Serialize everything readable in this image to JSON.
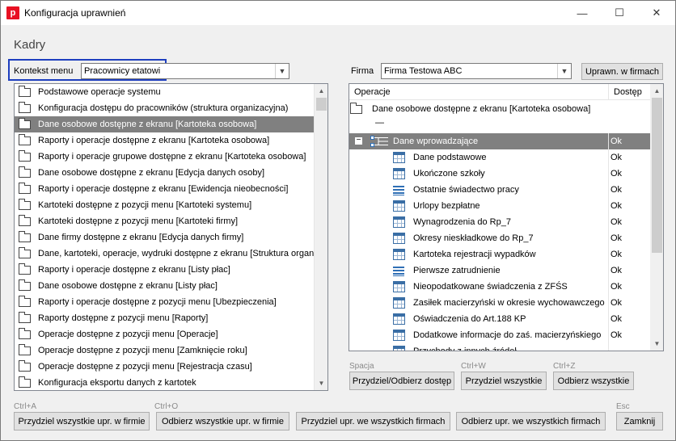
{
  "window": {
    "title": "Konfiguracja uprawnień",
    "app_icon_letter": "p"
  },
  "controls": {
    "minimize": "—",
    "maximize": "☐",
    "close": "✕"
  },
  "heading": "Kadry",
  "context": {
    "label": "Kontekst menu",
    "value": "Pracownicy etatowi"
  },
  "firma": {
    "label": "Firma",
    "value": "Firma Testowa ABC",
    "button": "Uprawn. w firmach"
  },
  "left_list": [
    "Podstawowe operacje systemu",
    "Konfiguracja dostępu do pracowników (struktura organizacyjna)",
    "Dane osobowe dostępne z ekranu [Kartoteka osobowa]",
    "Raporty i operacje dostępne z ekranu [Kartoteka osobowa]",
    "Raporty i operacje grupowe dostępne z ekranu [Kartoteka osobowa]",
    "Dane osobowe dostępne z ekranu [Edycja danych osoby]",
    "Raporty i operacje dostępne z ekranu [Ewidencja nieobecności]",
    "Kartoteki dostępne z pozycji menu [Kartoteki systemu]",
    "Kartoteki dostępne z pozycji menu [Kartoteki firmy]",
    "Dane firmy dostępne z ekranu [Edycja danych firmy]",
    "Dane, kartoteki, operacje, wydruki dostępne z ekranu [Struktura organiz",
    "Raporty i operacje dostępne z ekranu [Listy płac]",
    "Dane osobowe dostępne z ekranu [Listy płac]",
    "Raporty i operacje dostępne z pozycji menu [Ubezpieczenia]",
    "Raporty dostępne z pozycji menu [Raporty]",
    "Operacje dostępne z pozycji menu [Operacje]",
    "Operacje dostępne z pozycji menu [Zamknięcie roku]",
    "Operacje dostępne z pozycji menu [Rejestracja czasu]",
    "Konfiguracja eksportu danych z kartotek"
  ],
  "left_selected_index": 2,
  "tree": {
    "col_operacje": "Operacje",
    "col_dostep": "Dostęp",
    "root": "Dane osobowe dostępne z ekranu [Kartoteka osobowa]",
    "dash": "—",
    "group": {
      "name": "Dane wprowadzające",
      "access": "Ok"
    },
    "items": [
      {
        "name": "Dane podstawowe",
        "access": "Ok",
        "icon": "table-icon"
      },
      {
        "name": "Ukończone szkoły",
        "access": "Ok",
        "icon": "table-icon"
      },
      {
        "name": "Ostatnie świadectwo pracy",
        "access": "Ok",
        "icon": "stack-icon"
      },
      {
        "name": "Urlopy bezpłatne",
        "access": "Ok",
        "icon": "table-icon"
      },
      {
        "name": "Wynagrodzenia do Rp_7",
        "access": "Ok",
        "icon": "table-icon"
      },
      {
        "name": "Okresy nieskładkowe do Rp_7",
        "access": "Ok",
        "icon": "table-icon"
      },
      {
        "name": "Kartoteka rejestracji wypadków",
        "access": "Ok",
        "icon": "table-icon"
      },
      {
        "name": "Pierwsze zatrudnienie",
        "access": "Ok",
        "icon": "stack-icon"
      },
      {
        "name": "Nieopodatkowane świadczenia z ZFŚS",
        "access": "Ok",
        "icon": "table-icon"
      },
      {
        "name": "Zasiłek macierzyński w okresie wychowawczego",
        "access": "Ok",
        "icon": "table-icon"
      },
      {
        "name": "Oświadczenia do Art.188 KP",
        "access": "Ok",
        "icon": "table-icon"
      },
      {
        "name": "Dodatkowe informacje do zaś. macierzyńskiego",
        "access": "Ok",
        "icon": "table-icon"
      },
      {
        "name": "Przychody z innych źródeł",
        "access": "",
        "icon": "table-icon"
      }
    ]
  },
  "right_buttons": [
    {
      "hint": "Spacja",
      "label": "Przydziel/Odbierz dostęp"
    },
    {
      "hint": "Ctrl+W",
      "label": "Przydziel wszystkie"
    },
    {
      "hint": "Ctrl+Z",
      "label": "Odbierz wszystkie"
    }
  ],
  "bottom_buttons": [
    {
      "hint": "Ctrl+A",
      "label": "Przydziel wszystkie upr. w firmie"
    },
    {
      "hint": "Ctrl+O",
      "label": "Odbierz wszystkie upr. w firmie"
    },
    {
      "hint": "",
      "label": "Przydziel upr. we wszystkich firmach"
    },
    {
      "hint": "",
      "label": "Odbierz upr. we wszystkich firmach"
    },
    {
      "hint": "Esc",
      "label": "Zamknij"
    }
  ]
}
